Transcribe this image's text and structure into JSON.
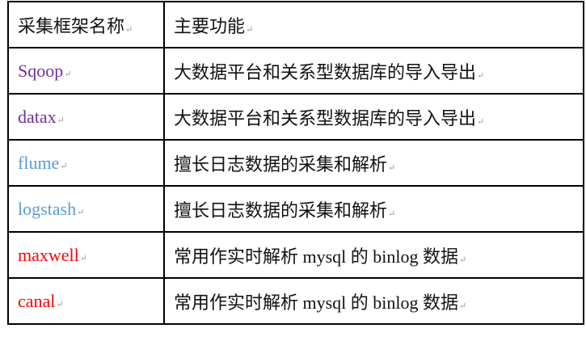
{
  "table": {
    "headers": [
      "采集框架名称",
      "主要功能"
    ],
    "rows": [
      {
        "name": "Sqoop",
        "function": "大数据平台和关系型数据库的导入导出",
        "color": "#7030A0"
      },
      {
        "name": "datax",
        "function": "大数据平台和关系型数据库的导入导出",
        "color": "#7030A0"
      },
      {
        "name": "flume",
        "function": "擅长日志数据的采集和解析",
        "color": "#5B9BD5"
      },
      {
        "name": "logstash",
        "function": "擅长日志数据的采集和解析",
        "color": "#5B9BD5"
      },
      {
        "name": "maxwell",
        "function": "常用作实时解析 mysql 的 binlog 数据",
        "color": "#FF0000"
      },
      {
        "name": "canal",
        "function": "常用作实时解析 mysql 的 binlog 数据",
        "color": "#FF0000"
      }
    ]
  },
  "paragraph_mark": "↵"
}
